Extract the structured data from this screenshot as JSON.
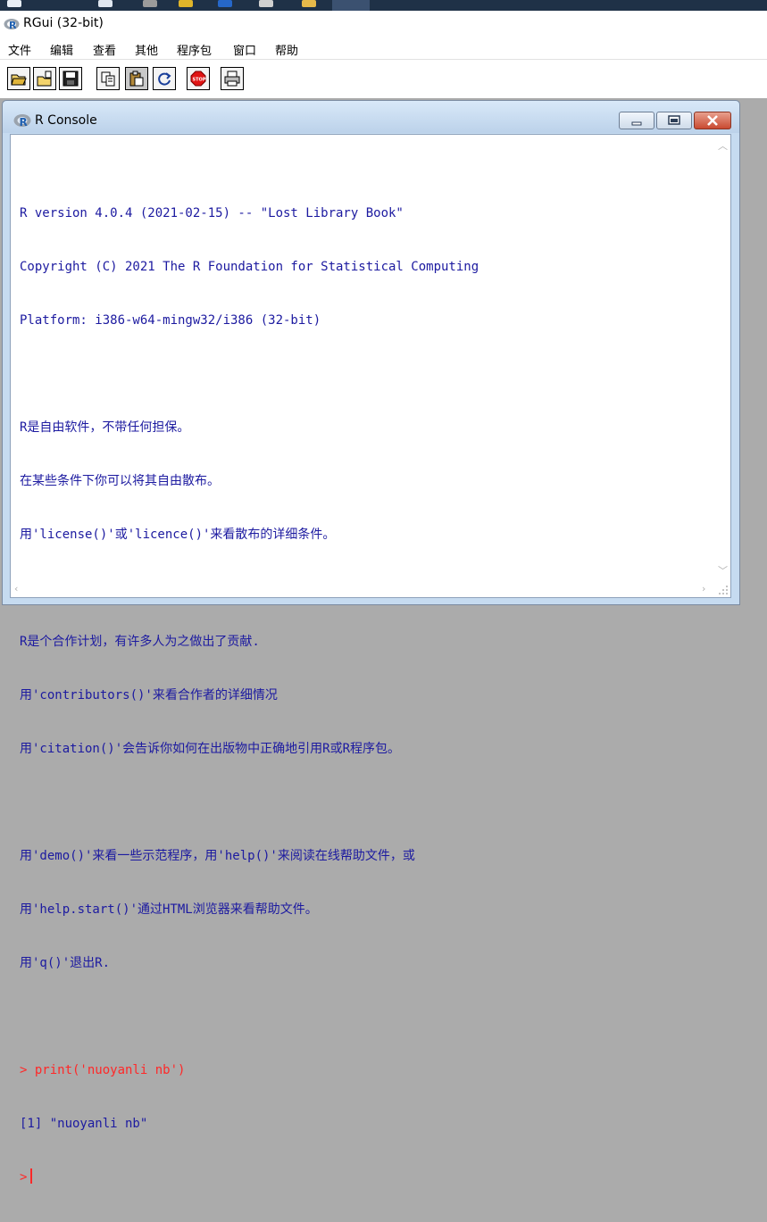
{
  "app": {
    "title": "RGui (32-bit)"
  },
  "menu": {
    "items": [
      "文件",
      "编辑",
      "查看",
      "其他",
      "程序包",
      "窗口",
      "帮助"
    ]
  },
  "toolbar": {
    "buttons": [
      {
        "icon": "open-script-icon"
      },
      {
        "icon": "load-workspace-icon"
      },
      {
        "icon": "save-icon"
      },
      {
        "icon": "copy-icon"
      },
      {
        "icon": "paste-icon"
      },
      {
        "icon": "refresh-icon"
      },
      {
        "icon": "stop-icon",
        "label": "STOP"
      },
      {
        "icon": "print-icon"
      }
    ]
  },
  "console": {
    "title": "R Console",
    "lines": [
      {
        "kind": "out",
        "text": "R version 4.0.4 (2021-02-15) -- \"Lost Library Book\""
      },
      {
        "kind": "out",
        "text": "Copyright (C) 2021 The R Foundation for Statistical Computing"
      },
      {
        "kind": "out",
        "text": "Platform: i386-w64-mingw32/i386 (32-bit)"
      },
      {
        "kind": "blank",
        "text": ""
      },
      {
        "kind": "out",
        "text": "R是自由软件，不带任何担保。"
      },
      {
        "kind": "out",
        "text": "在某些条件下你可以将其自由散布。"
      },
      {
        "kind": "out",
        "text": "用'license()'或'licence()'来看散布的详细条件。"
      },
      {
        "kind": "blank",
        "text": ""
      },
      {
        "kind": "out",
        "text": "R是个合作计划，有许多人为之做出了贡献."
      },
      {
        "kind": "out",
        "text": "用'contributors()'来看合作者的详细情况"
      },
      {
        "kind": "out",
        "text": "用'citation()'会告诉你如何在出版物中正确地引用R或R程序包。"
      },
      {
        "kind": "blank",
        "text": ""
      },
      {
        "kind": "out",
        "text": "用'demo()'来看一些示范程序，用'help()'来阅读在线帮助文件，或"
      },
      {
        "kind": "out",
        "text": "用'help.start()'通过HTML浏览器来看帮助文件。"
      },
      {
        "kind": "out",
        "text": "用'q()'退出R."
      },
      {
        "kind": "blank",
        "text": ""
      },
      {
        "kind": "cmd",
        "text": "> print('nuoyanli nb')"
      },
      {
        "kind": "out",
        "text": "[1] \"nuoyanli nb\""
      },
      {
        "kind": "prompt",
        "text": ">"
      }
    ]
  }
}
